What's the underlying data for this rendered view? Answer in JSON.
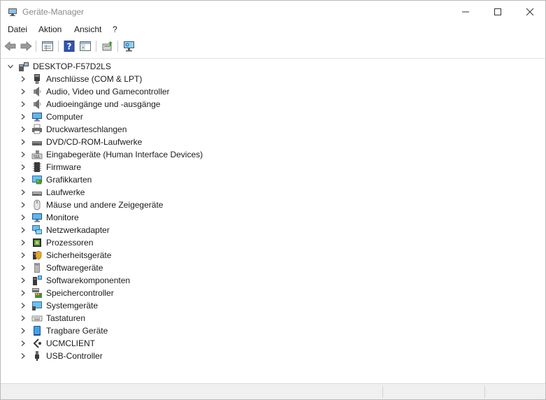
{
  "window": {
    "title": "Geräte-Manager",
    "icon": "device-manager-icon"
  },
  "menu": [
    {
      "label": "Datei"
    },
    {
      "label": "Aktion"
    },
    {
      "label": "Ansicht"
    },
    {
      "label": "?"
    }
  ],
  "toolbar": {
    "buttons": [
      {
        "icon": "back-arrow-icon"
      },
      {
        "icon": "forward-arrow-icon"
      },
      {
        "icon": "properties-view-icon"
      },
      {
        "icon": "help-icon"
      },
      {
        "icon": "console-tree-icon"
      },
      {
        "icon": "update-driver-icon"
      },
      {
        "icon": "scan-hardware-icon"
      }
    ]
  },
  "tree": {
    "root": {
      "label": "DESKTOP-F57D2LS",
      "icon": "computer-root-icon",
      "expanded": true
    },
    "categories": [
      {
        "label": "Anschlüsse (COM & LPT)",
        "icon": "port-icon"
      },
      {
        "label": "Audio, Video und Gamecontroller",
        "icon": "speaker-icon"
      },
      {
        "label": "Audioeingänge und -ausgänge",
        "icon": "speaker-icon"
      },
      {
        "label": "Computer",
        "icon": "monitor-icon"
      },
      {
        "label": "Druckwarteschlangen",
        "icon": "printer-icon"
      },
      {
        "label": "DVD/CD-ROM-Laufwerke",
        "icon": "dvd-drive-icon"
      },
      {
        "label": "Eingabegeräte (Human Interface Devices)",
        "icon": "hid-icon"
      },
      {
        "label": "Firmware",
        "icon": "firmware-icon"
      },
      {
        "label": "Grafikkarten",
        "icon": "display-adapter-icon"
      },
      {
        "label": "Laufwerke",
        "icon": "disk-drive-icon"
      },
      {
        "label": "Mäuse und andere Zeigegeräte",
        "icon": "mouse-icon"
      },
      {
        "label": "Monitore",
        "icon": "monitor-icon"
      },
      {
        "label": "Netzwerkadapter",
        "icon": "network-adapter-icon"
      },
      {
        "label": "Prozessoren",
        "icon": "processor-icon"
      },
      {
        "label": "Sicherheitsgeräte",
        "icon": "security-device-icon"
      },
      {
        "label": "Softwaregeräte",
        "icon": "software-device-icon"
      },
      {
        "label": "Softwarekomponenten",
        "icon": "software-component-icon"
      },
      {
        "label": "Speichercontroller",
        "icon": "storage-controller-icon"
      },
      {
        "label": "Systemgeräte",
        "icon": "system-device-icon"
      },
      {
        "label": "Tastaturen",
        "icon": "keyboard-icon"
      },
      {
        "label": "Tragbare Geräte",
        "icon": "portable-device-icon"
      },
      {
        "label": "UCMCLIENT",
        "icon": "ucm-client-icon"
      },
      {
        "label": "USB-Controller",
        "icon": "usb-icon"
      }
    ]
  }
}
